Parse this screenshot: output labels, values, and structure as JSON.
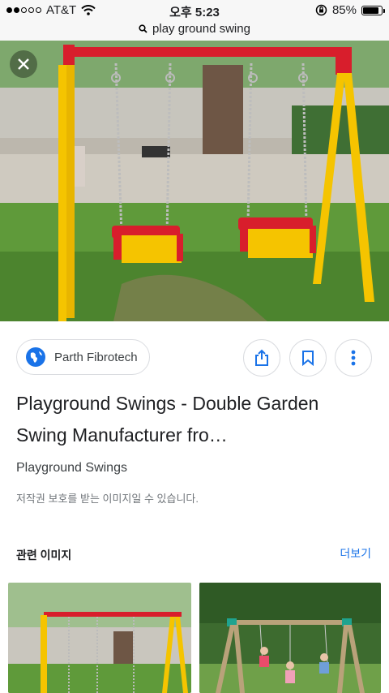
{
  "status_bar": {
    "carrier": "AT&T",
    "time": "오후 5:23",
    "battery": "85%",
    "battery_level": 0.85,
    "signal_bars_filled": 2,
    "signal_bars_total": 5
  },
  "url_bar": {
    "query": "play ground swing",
    "icon": "search-icon"
  },
  "hero": {
    "close_icon": "close-icon"
  },
  "source": {
    "name": "Parth Fibrotech",
    "icon": "globe-icon"
  },
  "actions": {
    "share": "share-icon",
    "save": "bookmark-icon",
    "more": "more-vert-icon"
  },
  "result": {
    "title": "Playground Swings - Double Garden Swing Manufacturer fro…",
    "subtitle": "Playground Swings",
    "copyright_notice": "저작권 보호를 받는 이미지일 수 있습니다."
  },
  "related": {
    "heading": "관련 이미지",
    "more_label": "더보기"
  },
  "colors": {
    "accent": "#1a73e8",
    "swing_frame": "#f5c400",
    "swing_red": "#d81e2c"
  }
}
